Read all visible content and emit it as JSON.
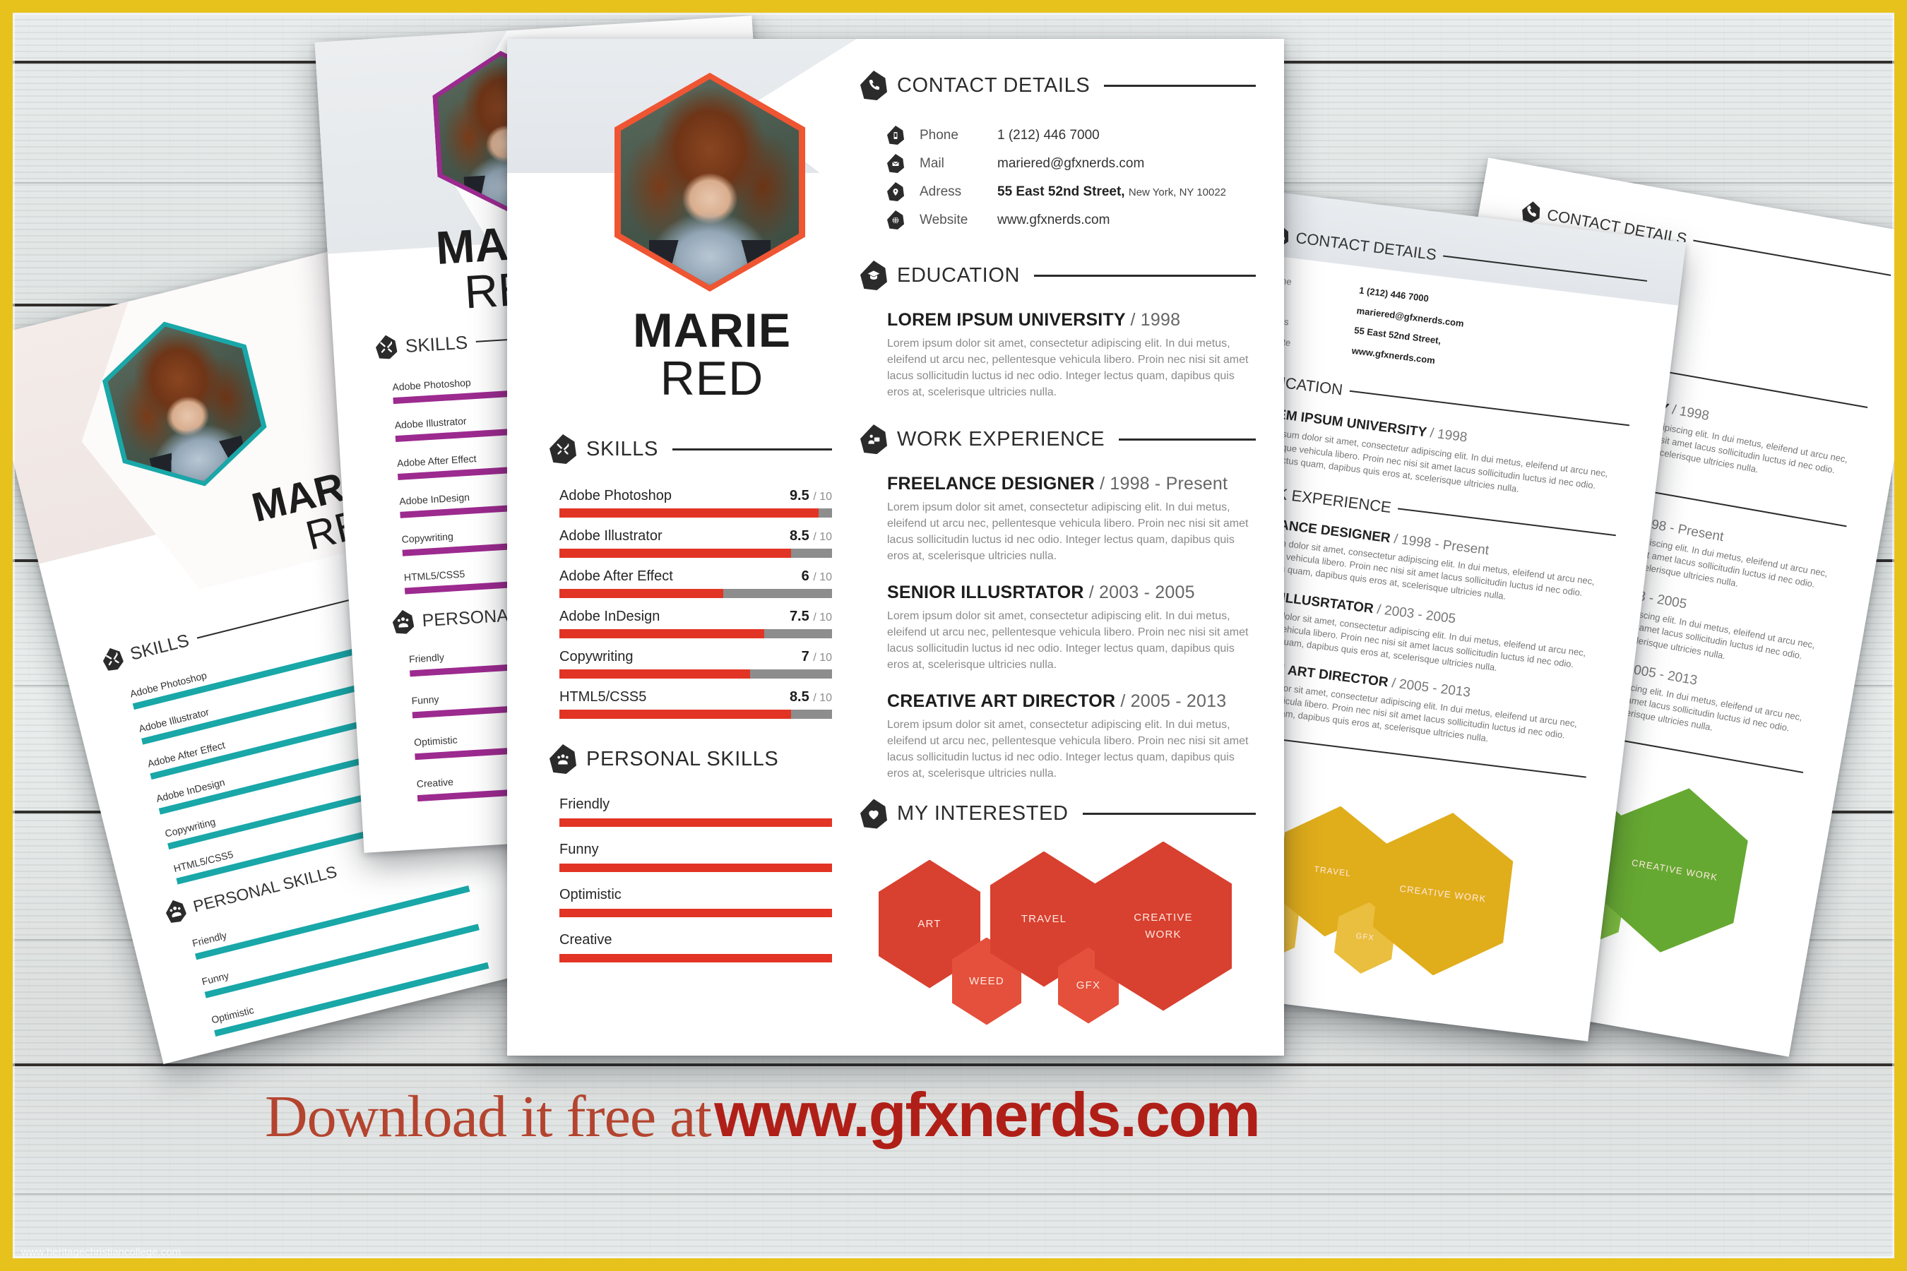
{
  "page": {
    "frame_color": "#e8c21c",
    "background": "whitewashed-wood-planks",
    "watermark": "www.heritagechristiancollege.com"
  },
  "banner": {
    "lead": "Download it free at",
    "site": "www.gfxnerds.com"
  },
  "resume": {
    "accent_color": "#e23424",
    "name_first": "MARIE",
    "name_last": "RED",
    "contact": {
      "heading": "CONTACT DETAILS",
      "icon": "phone-icon",
      "rows": [
        {
          "icon": "mobile-icon",
          "label": "Phone",
          "value": "1 (212) 446 7000",
          "value_small": ""
        },
        {
          "icon": "envelope-icon",
          "label": "Mail",
          "value": "mariered@gfxnerds.com",
          "value_small": ""
        },
        {
          "icon": "pin-icon",
          "label": "Adress",
          "value": "55 East 52nd Street,",
          "value_small": "New York, NY 10022"
        },
        {
          "icon": "globe-icon",
          "label": "Website",
          "value": "www.gfxnerds.com",
          "value_small": ""
        }
      ]
    },
    "education": {
      "heading": "EDUCATION",
      "icon": "graduation-cap-icon",
      "entries": [
        {
          "title": "LOREM IPSUM UNIVERSITY",
          "date": "/ 1998",
          "body": "Lorem ipsum dolor sit amet, consectetur adipiscing elit. In dui metus, eleifend ut arcu nec, pellentesque vehicula libero. Proin nec nisi sit amet lacus sollicitudin luctus id nec odio. Integer lectus quam, dapibus quis eros at, scelerisque ultricies nulla."
        }
      ]
    },
    "work": {
      "heading": "WORK EXPERIENCE",
      "icon": "briefcase-person-icon",
      "entries": [
        {
          "title": "FREELANCE DESIGNER",
          "date": "/ 1998 - Present",
          "body": "Lorem ipsum dolor sit amet, consectetur adipiscing elit. In dui metus, eleifend ut arcu nec, pellentesque vehicula libero. Proin nec nisi sit amet lacus sollicitudin luctus id nec odio. Integer lectus quam, dapibus quis eros at, scelerisque ultricies nulla."
        },
        {
          "title": "SENIOR ILLUSRTATOR",
          "date": "/ 2003 - 2005",
          "body": "Lorem ipsum dolor sit amet, consectetur adipiscing elit. In dui metus, eleifend ut arcu nec, pellentesque vehicula libero. Proin nec nisi sit amet lacus sollicitudin luctus id nec odio. Integer lectus quam, dapibus quis eros at, scelerisque ultricies nulla."
        },
        {
          "title": "CREATIVE ART DIRECTOR",
          "date": "/ 2005 - 2013",
          "body": "Lorem ipsum dolor sit amet, consectetur adipiscing elit. In dui metus, eleifend ut arcu nec, pellentesque vehicula libero. Proin nec nisi sit amet lacus sollicitudin luctus id nec odio. Integer lectus quam, dapibus quis eros at, scelerisque ultricies nulla."
        }
      ]
    },
    "skills": {
      "heading": "SKILLS",
      "icon": "tools-icon",
      "denominator": "/ 10",
      "items": [
        {
          "name": "Adobe Photoshop",
          "value": "9.5",
          "pct": 95
        },
        {
          "name": "Adobe Illustrator",
          "value": "8.5",
          "pct": 85
        },
        {
          "name": "Adobe After Effect",
          "value": "6",
          "pct": 60
        },
        {
          "name": "Adobe InDesign",
          "value": "7.5",
          "pct": 75
        },
        {
          "name": "Copywriting",
          "value": "7",
          "pct": 70
        },
        {
          "name": "HTML5/CSS5",
          "value": "8.5",
          "pct": 85
        }
      ]
    },
    "personal_skills": {
      "heading": "PERSONAL SKILLS",
      "icon": "people-icon",
      "items": [
        {
          "name": "Friendly",
          "pct": 100
        },
        {
          "name": "Funny",
          "pct": 100
        },
        {
          "name": "Optimistic",
          "pct": 100
        },
        {
          "name": "Creative",
          "pct": 100
        }
      ]
    },
    "interests": {
      "heading": "MY INTERESTED",
      "icon": "heart-icon",
      "items": [
        {
          "label": "ART",
          "size": "large"
        },
        {
          "label": "WEED",
          "size": "medium"
        },
        {
          "label": "TRAVEL",
          "size": "large"
        },
        {
          "label": "GFX",
          "size": "small"
        },
        {
          "label": "CREATIVE WORK",
          "size": "xlarge"
        }
      ]
    }
  },
  "variants": [
    {
      "name": "teal-variant",
      "accent": "#19a7a8"
    },
    {
      "name": "purple-variant",
      "accent": "#9c2a8f"
    },
    {
      "name": "yellow-variant",
      "accent": "#e0ad1b"
    },
    {
      "name": "green-variant",
      "accent": "#66a932"
    }
  ]
}
